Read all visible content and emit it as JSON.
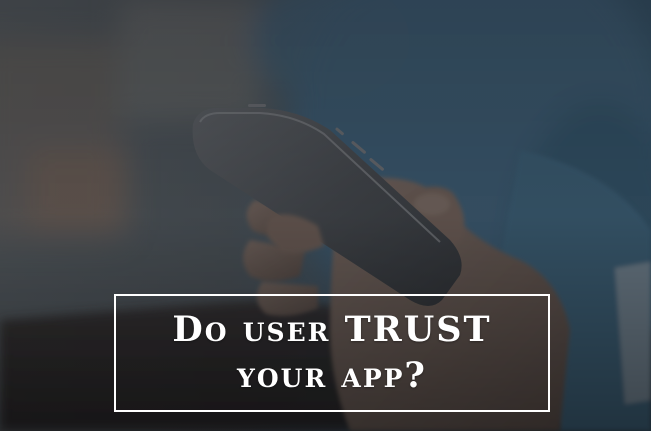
{
  "headline": {
    "line1": "Do user TRUST",
    "line2": "your app?"
  },
  "colors": {
    "overlay": "#2b3035",
    "shirt": "#4f7a99",
    "skin": "#8a7468",
    "phone": "#5a5e63",
    "caption_text": "#ffffff",
    "caption_border": "#ffffff"
  },
  "image": {
    "subject": "hand holding smartphone",
    "icon": "smartphone-photo"
  }
}
